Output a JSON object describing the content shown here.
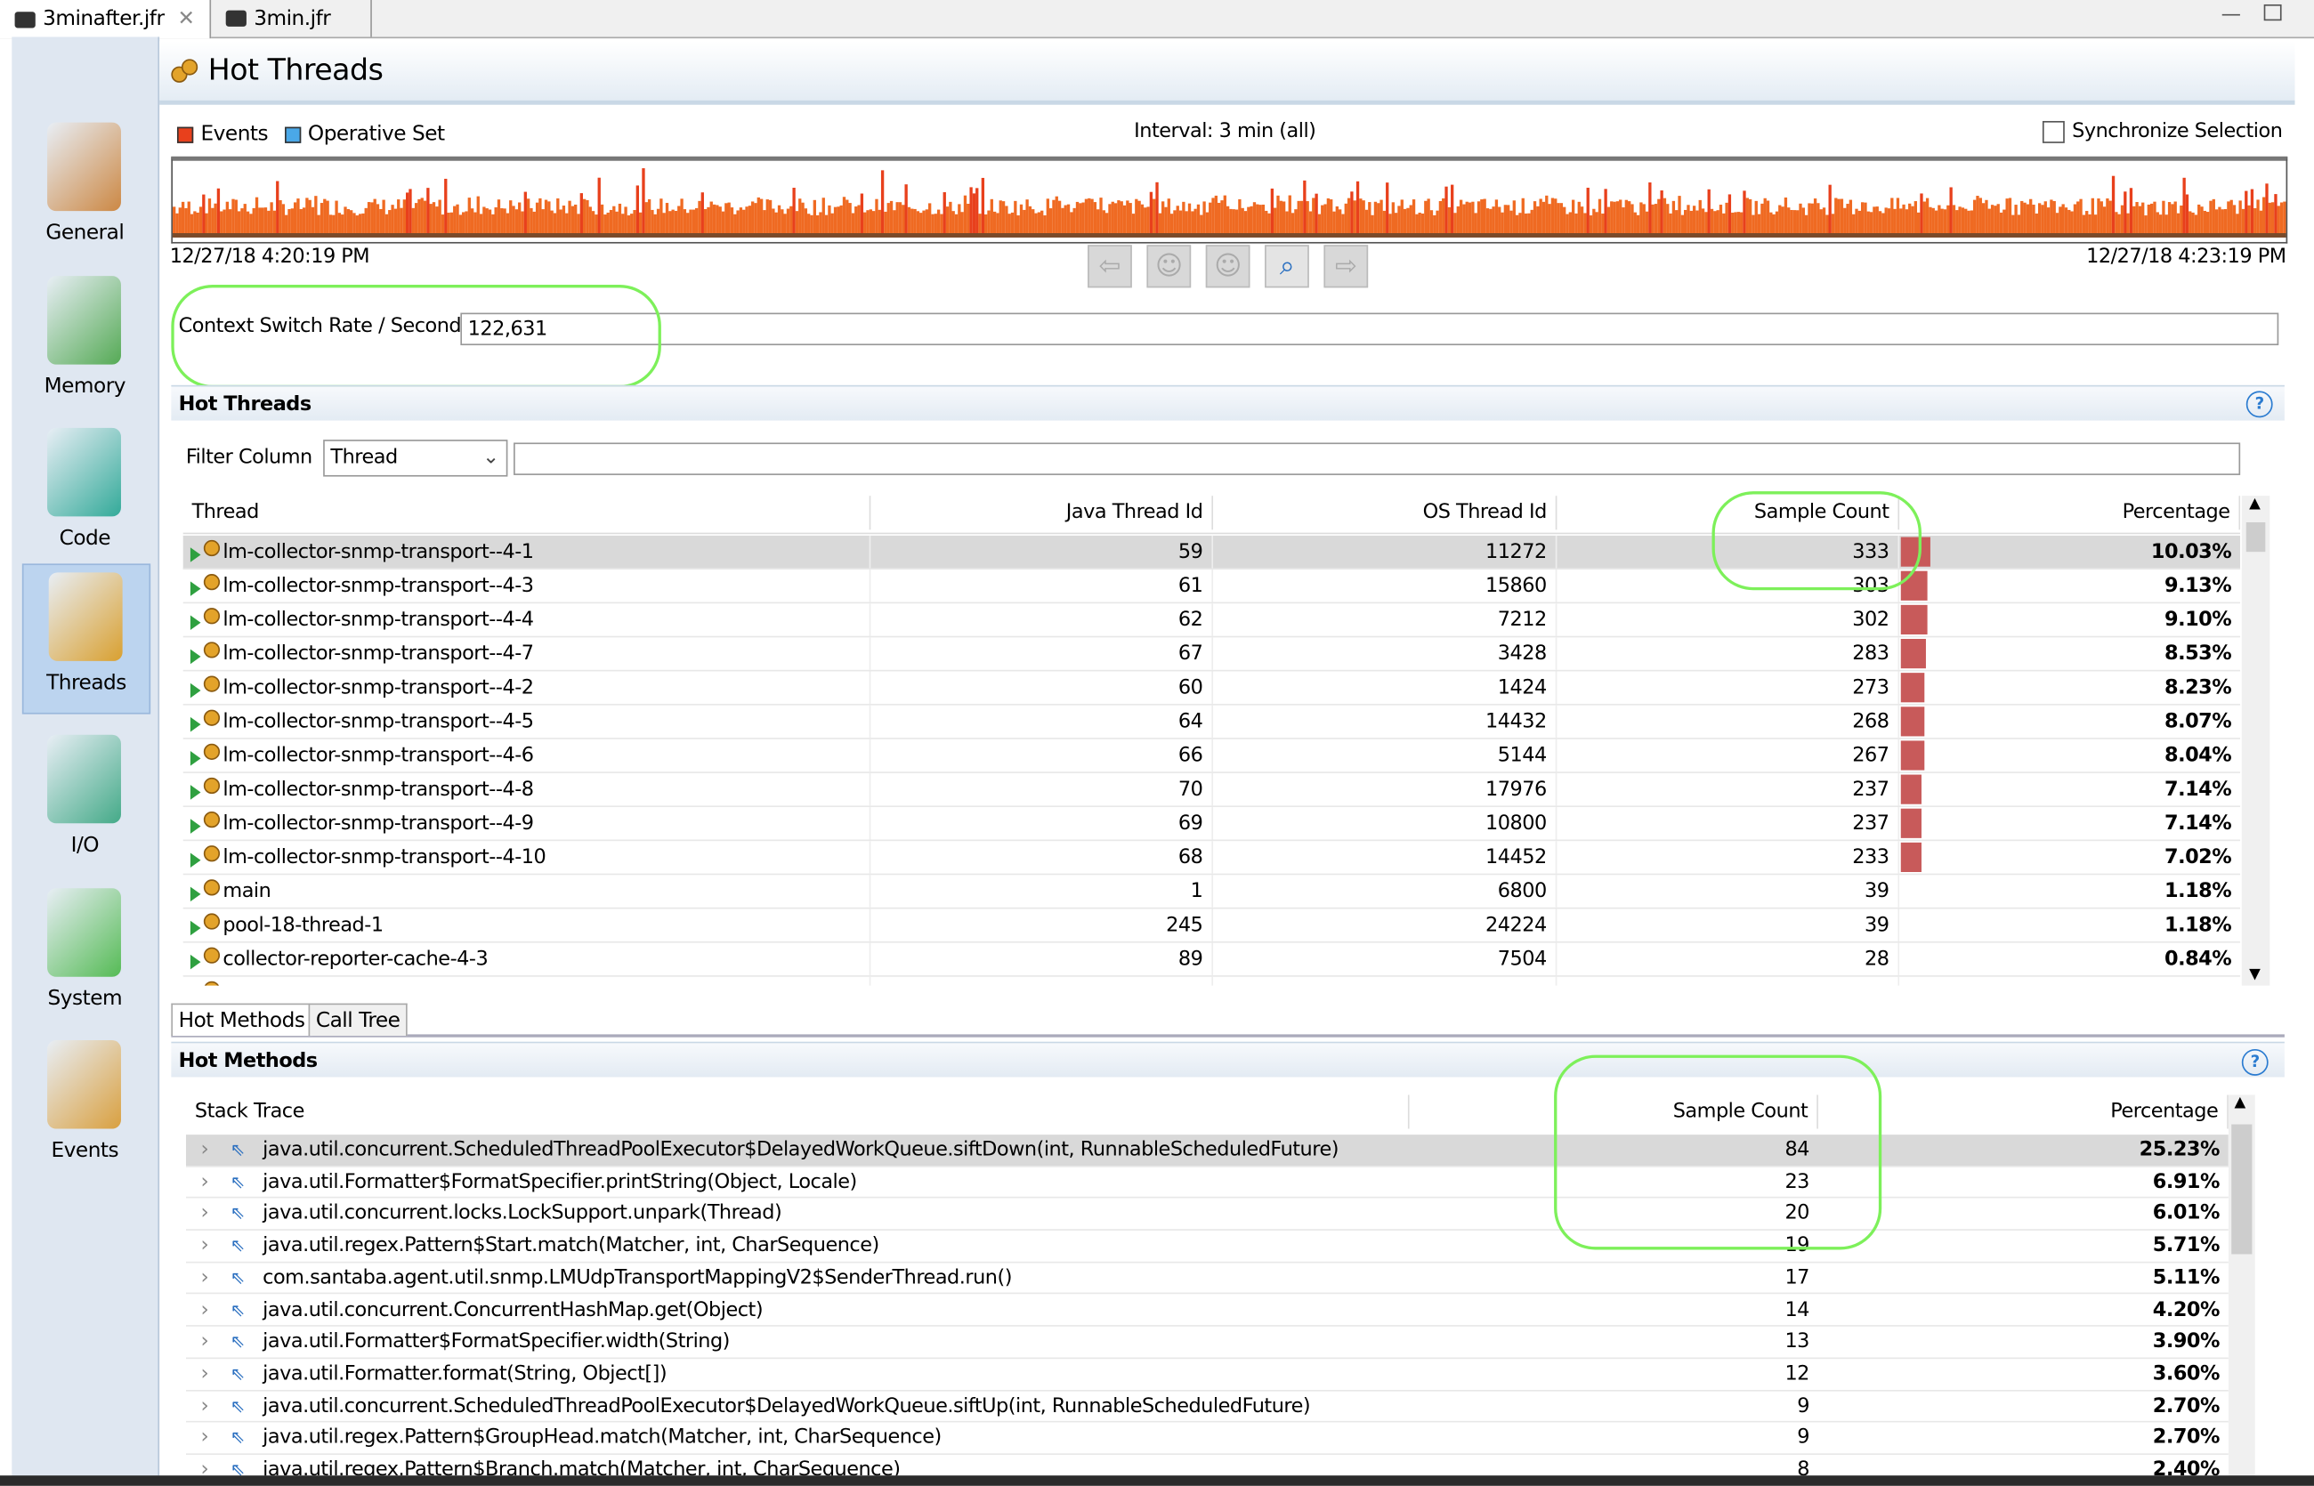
{
  "file_tabs": [
    {
      "label": "3minafter.jfr",
      "active": true,
      "closable": true
    },
    {
      "label": "3min.jfr",
      "active": false
    }
  ],
  "sidebar": {
    "items": [
      {
        "label": "General",
        "icon": "gauge-chart-icon"
      },
      {
        "label": "Memory",
        "icon": "memory-chip-icon"
      },
      {
        "label": "Code",
        "icon": "code-icon"
      },
      {
        "label": "Threads",
        "icon": "threads-gear-icon",
        "selected": true
      },
      {
        "label": "I/O",
        "icon": "io-arrows-icon"
      },
      {
        "label": "System",
        "icon": "system-icon"
      },
      {
        "label": "Events",
        "icon": "events-box-icon"
      }
    ]
  },
  "page": {
    "title": "Hot Threads"
  },
  "timeline": {
    "legend": [
      {
        "label": "Events",
        "color": "#e8401c"
      },
      {
        "label": "Operative Set",
        "color": "#4aa8e8"
      }
    ],
    "interval": "Interval: 3 min (all)",
    "sync_label": "Synchronize Selection",
    "sync_checked": false,
    "start": "12/27/18 4:20:19 PM",
    "end": "12/27/18 4:23:19 PM",
    "bar_color": "#ef6a22"
  },
  "context_switch": {
    "label": "Context Switch Rate / Second",
    "value": "122,631"
  },
  "hot_threads": {
    "title": "Hot Threads",
    "filter_label": "Filter Column",
    "filter_value": "Thread",
    "filter_text": "",
    "columns": [
      "Thread",
      "Java Thread Id",
      "OS Thread Id",
      "Sample Count",
      "Percentage"
    ],
    "rows": [
      [
        "lm-collector-snmp-transport--4-1",
        "59",
        "11272",
        "333",
        "10.03%"
      ],
      [
        "lm-collector-snmp-transport--4-3",
        "61",
        "15860",
        "303",
        "9.13%"
      ],
      [
        "lm-collector-snmp-transport--4-4",
        "62",
        "7212",
        "302",
        "9.10%"
      ],
      [
        "lm-collector-snmp-transport--4-7",
        "67",
        "3428",
        "283",
        "8.53%"
      ],
      [
        "lm-collector-snmp-transport--4-2",
        "60",
        "1424",
        "273",
        "8.23%"
      ],
      [
        "lm-collector-snmp-transport--4-5",
        "64",
        "14432",
        "268",
        "8.07%"
      ],
      [
        "lm-collector-snmp-transport--4-6",
        "66",
        "5144",
        "267",
        "8.04%"
      ],
      [
        "lm-collector-snmp-transport--4-8",
        "70",
        "17976",
        "237",
        "7.14%"
      ],
      [
        "lm-collector-snmp-transport--4-9",
        "69",
        "10800",
        "237",
        "7.14%"
      ],
      [
        "lm-collector-snmp-transport--4-10",
        "68",
        "14452",
        "233",
        "7.02%"
      ],
      [
        "main",
        "1",
        "6800",
        "39",
        "1.18%"
      ],
      [
        "pool-18-thread-1",
        "245",
        "24224",
        "39",
        "1.18%"
      ],
      [
        "collector-reporter-cache-4-3",
        "89",
        "7504",
        "28",
        "0.84%"
      ]
    ],
    "bar_color": "#c85a5a"
  },
  "bottom_tabs": [
    "Hot Methods",
    "Call Tree"
  ],
  "hot_methods": {
    "title": "Hot Methods",
    "columns": [
      "Stack Trace",
      "Sample Count",
      "Percentage"
    ],
    "rows": [
      [
        "java.util.concurrent.ScheduledThreadPoolExecutor$DelayedWorkQueue.siftDown(int, RunnableScheduledFuture)",
        "84",
        "25.23%"
      ],
      [
        "java.util.Formatter$FormatSpecifier.printString(Object, Locale)",
        "23",
        "6.91%"
      ],
      [
        "java.util.concurrent.locks.LockSupport.unpark(Thread)",
        "20",
        "6.01%"
      ],
      [
        "java.util.regex.Pattern$Start.match(Matcher, int, CharSequence)",
        "19",
        "5.71%"
      ],
      [
        "com.santaba.agent.util.snmp.LMUdpTransportMappingV2$SenderThread.run()",
        "17",
        "5.11%"
      ],
      [
        "java.util.concurrent.ConcurrentHashMap.get(Object)",
        "14",
        "4.20%"
      ],
      [
        "java.util.Formatter$FormatSpecifier.width(String)",
        "13",
        "3.90%"
      ],
      [
        "java.util.Formatter.format(String, Object[])",
        "12",
        "3.60%"
      ],
      [
        "java.util.concurrent.ScheduledThreadPoolExecutor$DelayedWorkQueue.siftUp(int, RunnableScheduledFuture)",
        "9",
        "2.70%"
      ],
      [
        "java.util.regex.Pattern$GroupHead.match(Matcher, int, CharSequence)",
        "9",
        "2.70%"
      ],
      [
        "java.util.regex.Pattern$Branch.match(Matcher, int, CharSequence)",
        "8",
        "2.40%"
      ]
    ]
  }
}
